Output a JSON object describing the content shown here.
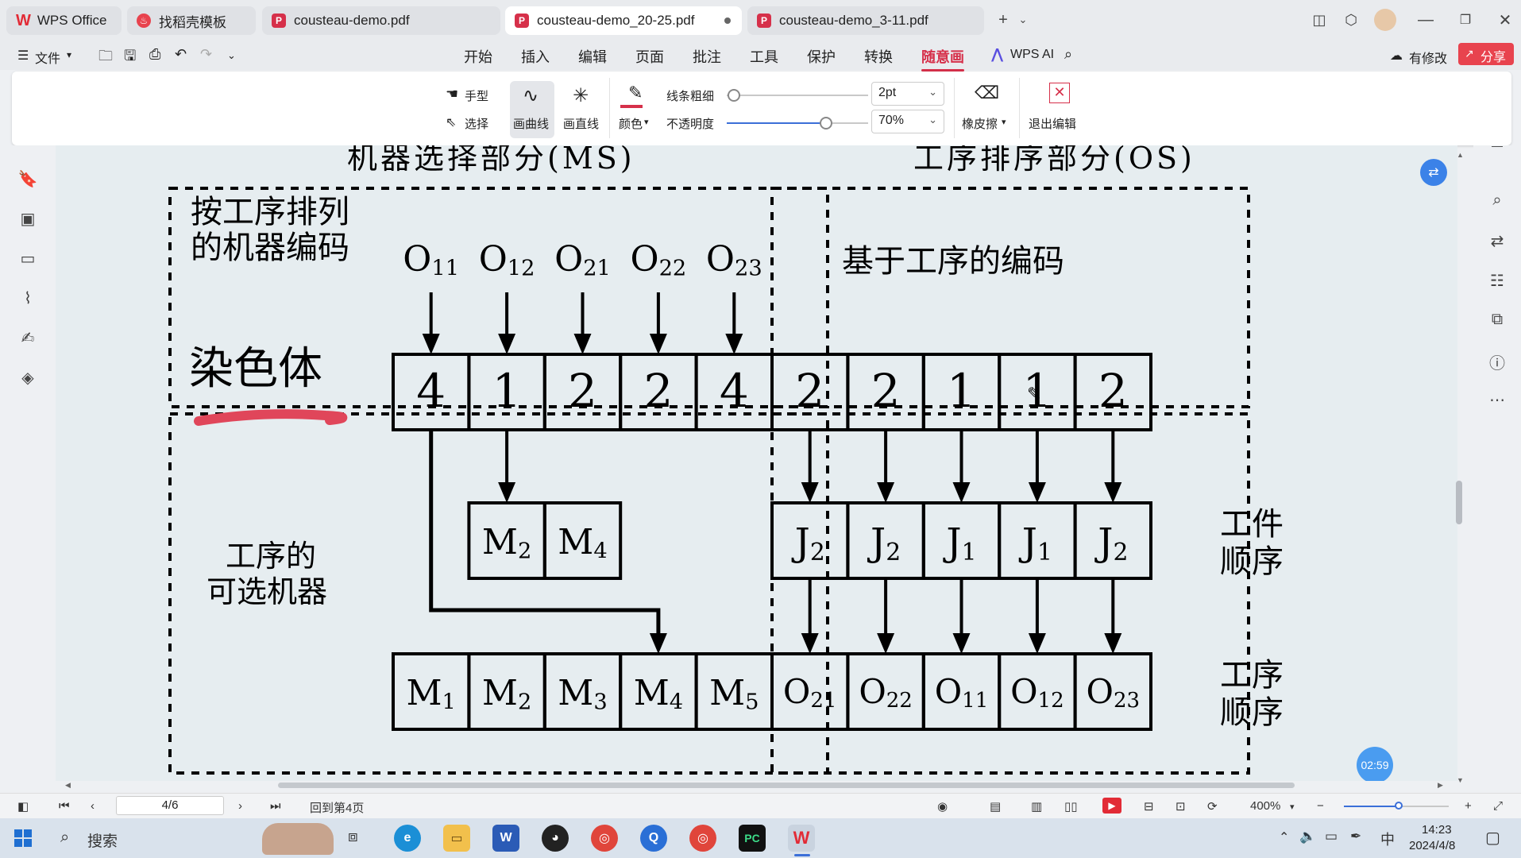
{
  "tabs": [
    {
      "label": "WPS Office"
    },
    {
      "label": "找稻壳模板"
    },
    {
      "label": "cousteau-demo.pdf"
    },
    {
      "label": "cousteau-demo_20-25.pdf"
    },
    {
      "label": "cousteau-demo_3-11.pdf"
    }
  ],
  "menu": {
    "file": "文件",
    "items": [
      "开始",
      "插入",
      "编辑",
      "页面",
      "批注",
      "工具",
      "保护",
      "转换",
      "随意画",
      "WPS AI"
    ],
    "modified": "有修改",
    "share": "分享"
  },
  "ribbon": {
    "hand": "手型",
    "select": "选择",
    "curve": "画曲线",
    "line": "画直线",
    "color": "颜色",
    "pen_color": "#d6304a",
    "stroke_label": "线条粗细",
    "stroke_value": "2pt",
    "stroke_level": 0.05,
    "opacity_label": "不透明度",
    "opacity_value": "70%",
    "opacity_level": 0.7,
    "eraser": "橡皮擦",
    "exit": "退出编辑"
  },
  "figure": {
    "title_ms": "机器选择部分(MS)",
    "title_os": "工序排序部分(OS)",
    "ms_label": [
      "按工序排列",
      "的机器编码"
    ],
    "os_label": "基于工序的编码",
    "ops_top": [
      "O",
      "O",
      "O",
      "O",
      "O"
    ],
    "ops_top_sub": [
      "11",
      "12",
      "21",
      "22",
      "23"
    ],
    "chromosome_label": "染色体",
    "chromosome": [
      "4",
      "1",
      "2",
      "2",
      "4",
      "2",
      "2",
      "1",
      "1",
      "2"
    ],
    "optional_label": [
      "工序的",
      "可选机器"
    ],
    "optional_m": [
      "M",
      "M"
    ],
    "optional_m_sub": [
      "2",
      "4"
    ],
    "jobs": [
      "J",
      "J",
      "J",
      "J",
      "J"
    ],
    "jobs_sub": [
      "2",
      "2",
      "1",
      "1",
      "2"
    ],
    "job_label": [
      "工件",
      "顺序"
    ],
    "machines": [
      "M",
      "M",
      "M",
      "M",
      "M"
    ],
    "machines_sub": [
      "1",
      "2",
      "3",
      "4",
      "5"
    ],
    "ops_bottom": [
      "O",
      "O",
      "O",
      "O",
      "O"
    ],
    "ops_bottom_sub": [
      "21",
      "22",
      "11",
      "12",
      "23"
    ],
    "op_label": [
      "工序",
      "顺序"
    ]
  },
  "timer": "02:59",
  "status": {
    "page": "4/6",
    "back": "回到第4页",
    "zoom": "400%"
  },
  "taskbar": {
    "search": "搜索",
    "ime": "中",
    "time": "14:23",
    "date": "2024/4/8"
  }
}
